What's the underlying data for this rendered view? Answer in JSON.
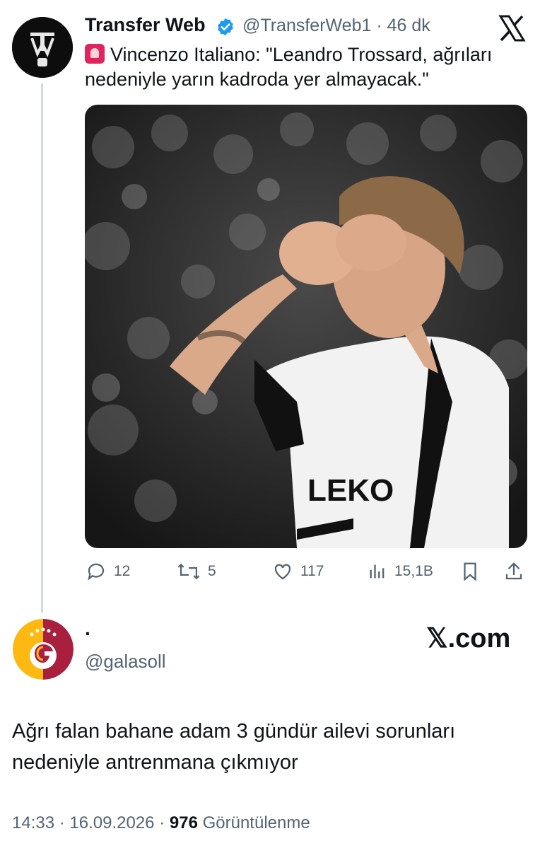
{
  "quoted_tweet": {
    "author_name": "Transfer Web",
    "handle": "@TransferWeb1",
    "time_ago": "46 dk",
    "separator": "·",
    "text": "Vincenzo Italiano: \"Leandro Trossard, ağrıları nedeniyle yarın kadroda yer almayacak.\"",
    "emoji_icon": "police-siren-icon",
    "actions": {
      "replies": "12",
      "reposts": "5",
      "likes": "117",
      "views": "15,1B"
    }
  },
  "main_tweet": {
    "author_name": "·",
    "handle": "@galasoll",
    "watermark": "𝕏.com",
    "text": "Ağrı falan bahane adam 3 gündür ailevi sorunları nedeniyle antrenmana çıkmıyor",
    "time": "14:33",
    "date": "16.09.2026",
    "views_count": "976",
    "views_label": "Görüntülenme",
    "separator": "·"
  },
  "colors": {
    "verified_blue": "#1d9bf0",
    "secondary_text": "#536471",
    "galatasaray_red": "#a9203e",
    "galatasaray_yellow": "#fdb912"
  }
}
